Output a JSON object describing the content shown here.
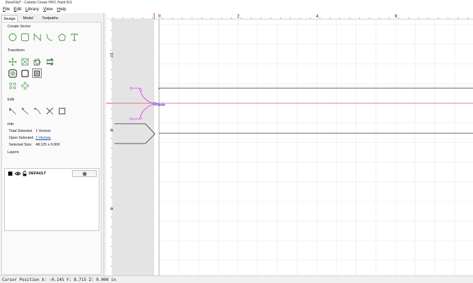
{
  "window": {
    "title": "[NewFile]* - Carbide Create PRO, Build 816"
  },
  "menu": [
    {
      "underline": "F",
      "rest": "ile"
    },
    {
      "underline": "E",
      "rest": "dit"
    },
    {
      "underline": "L",
      "rest": "ibrary"
    },
    {
      "underline": "V",
      "rest": "iew"
    },
    {
      "underline": "H",
      "rest": "elp"
    }
  ],
  "tabs": [
    "Design",
    "Model",
    "Toolpaths"
  ],
  "sections": {
    "create_vector": "Create Vector",
    "transform": "Transform",
    "edit": "Edit",
    "info": "Info",
    "layers": "Layers"
  },
  "create_vector_icons": [
    "circle-icon",
    "rectangle-icon",
    "polyline-icon",
    "curve-icon",
    "polygon-icon",
    "text-icon"
  ],
  "transform_icons": [
    "move-icon",
    "resize-icon",
    "rotate-icon",
    "mirror-icon",
    "offset-icon",
    "join-icon",
    "boolean-icon",
    "circular-array-icon",
    "linear-array-icon",
    "pattern-icon"
  ],
  "edit_icons": [
    "node-edit-icon",
    "trim-icon",
    "fillet-icon",
    "cut-icon",
    "align-icon"
  ],
  "info": {
    "total_selected_label": "Total Selected:",
    "total_selected_value": "1 Vectors",
    "open_selected_label": "Open Selected:",
    "open_selected_value": "1 Vectors",
    "selected_size_label": "Selected Size:",
    "selected_size_value": "48.125 x 0.000"
  },
  "layers": [
    {
      "name": "DEFAULT",
      "color": "#000000",
      "visible": true,
      "locked": false
    }
  ],
  "canvas": {
    "ruler_top": [
      "0",
      "2",
      "4",
      "6"
    ],
    "ruler_left": [
      "10",
      "8",
      "6"
    ],
    "node_label": "Node"
  },
  "colors": {
    "accent_green": "#5aa55a",
    "vector": "#2a2a2a",
    "selection": "#e040e0",
    "origin_line": "#e05050",
    "node_text": "#0000dd"
  },
  "status": {
    "text": "Cursor Position X: -0.145 Y: 8.715 Z: 0.000 in"
  }
}
